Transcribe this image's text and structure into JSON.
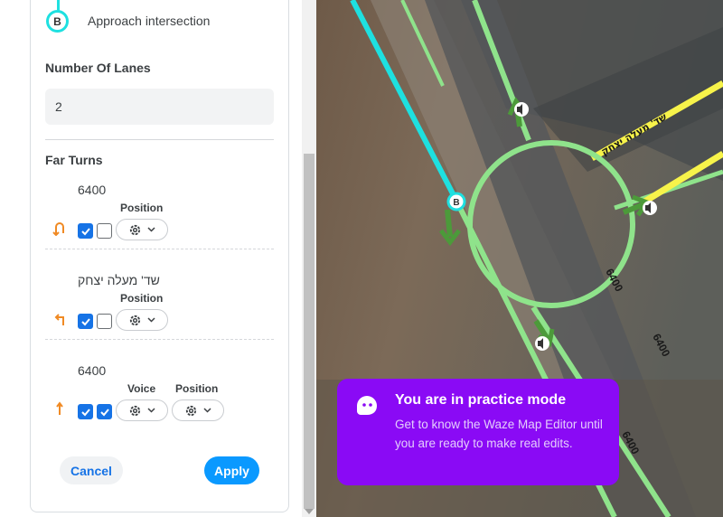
{
  "panel": {
    "node_badge": "B",
    "approach_label": "Approach intersection",
    "lanes": {
      "label": "Number Of Lanes",
      "value": "2"
    },
    "far_turns": {
      "label": "Far Turns",
      "turns": [
        {
          "name": "6400",
          "direction": "u-turn",
          "columns": [
            "Position"
          ],
          "voice_checked": true,
          "position_checked": false
        },
        {
          "name": "שד' מעלה יצחק",
          "direction": "left",
          "columns": [
            "Position"
          ],
          "voice_checked": true,
          "position_checked": false
        },
        {
          "name": "6400",
          "direction": "straight",
          "columns": [
            "Voice",
            "Position"
          ],
          "voice_checked": true,
          "position_checked": true
        }
      ]
    },
    "buttons": {
      "cancel": "Cancel",
      "apply": "Apply"
    }
  },
  "map": {
    "node_badge": "B",
    "road_labels": {
      "yellow": "שד' מעלה יצחק",
      "green": "6400"
    }
  },
  "toast": {
    "title": "You are in practice mode",
    "body": "Get to know the Waze Map Editor until you are ready to make real edits."
  },
  "colors": {
    "accent": "#1673e6",
    "apply": "#0a99ff",
    "node": "#1ee0e0",
    "toast": "#8a0af5",
    "turn_arrow": "#f08a24",
    "road_green": "#8fe38b",
    "road_yellow": "#f7f34a"
  }
}
